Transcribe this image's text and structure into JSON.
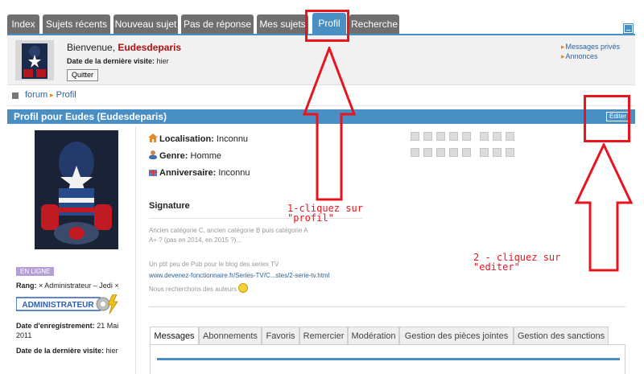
{
  "nav": {
    "tabs": [
      {
        "label": "Index"
      },
      {
        "label": "Sujets récents"
      },
      {
        "label": "Nouveau sujet"
      },
      {
        "label": "Pas de réponse"
      },
      {
        "label": "Mes sujets"
      },
      {
        "label": "Profil",
        "active": true
      },
      {
        "label": "Recherche"
      }
    ]
  },
  "welcome": {
    "greeting": "Bienvenue, ",
    "username": "Eudesdeparis",
    "last_visit_label": "Date de la dernière visite:",
    "last_visit_value": "hier",
    "quit_label": "Quitter",
    "links": [
      "Messages privés",
      "Annonces"
    ]
  },
  "breadcrumb": {
    "items": [
      "forum",
      "Profil"
    ]
  },
  "profile": {
    "title": "Profil pour Eudes (Eudesdeparis)",
    "edit_label": "Editer",
    "location_label": "Localisation:",
    "location_value": "Inconnu",
    "gender_label": "Genre:",
    "gender_value": "Homme",
    "birthday_label": "Anniversaire:",
    "birthday_value": "Inconnu",
    "signature_title": "Signature",
    "signature_lines": [
      "Ancien catégorie C, ancien catégorie B puis catégorie A",
      "A+ ? (pas en 2014, en 2015 ?)...",
      "Un ptit peu de Pub pour le blog des series TV"
    ],
    "signature_link": "www.devenez-fonctionnaire.fr/Series-TV/C...stes/2-serie-tv.html",
    "signature_last": "Nous recherchons des auteurs"
  },
  "sidebar": {
    "online_label": "EN LIGNE",
    "rank_label": "Rang:",
    "rank_value": "× Administrateur – Jedi ×",
    "rank_image_text": "ADMINISTRATEUR",
    "reg_label": "Date d'enregistrement:",
    "reg_value": "21 Mai 2011",
    "last_visit_label": "Date de la dernière visite:",
    "last_visit_value": "hier"
  },
  "bottom_tabs": [
    "Messages",
    "Abonnements",
    "Favoris",
    "Remercier",
    "Modération",
    "Gestion des pièces jointes",
    "Gestion des sanctions"
  ],
  "annotations": {
    "step1": "1-cliquez sur\n\"profil\"",
    "step2": "2 - cliquez sur\n\"editer\""
  },
  "colors": {
    "accent": "#4a8fc4",
    "tab_grey": "#6f6f6f",
    "username_red": "#b40d0d",
    "annotation_red": "#e8141e",
    "link_blue": "#2a5f9a"
  }
}
